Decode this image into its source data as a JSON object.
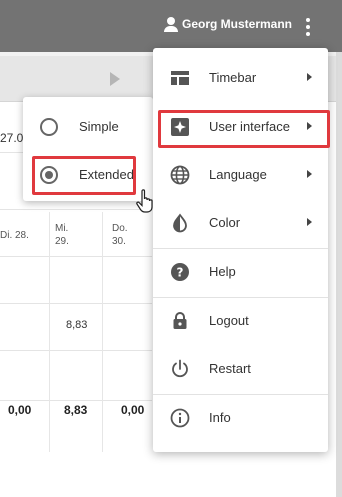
{
  "header": {
    "user_name": "Georg Mustermann",
    "user_icon": "account-icon",
    "more_icon": "more-vert-icon"
  },
  "toolbar": {
    "play_icon": "play-icon",
    "date_fragment": "27.0"
  },
  "table": {
    "columns": [
      {
        "day": "Di. 28.",
        "day2": ""
      },
      {
        "day": "Mi.",
        "day2": "29."
      },
      {
        "day": "Do.",
        "day2": "30."
      }
    ],
    "value": "8,83",
    "totals": [
      "0,00",
      "8,83",
      "0,00"
    ]
  },
  "submenu": {
    "items": [
      {
        "label": "Simple",
        "selected": false
      },
      {
        "label": "Extended",
        "selected": true
      }
    ]
  },
  "menu": {
    "items": [
      {
        "label": "Timebar",
        "icon": "timebar-icon",
        "submenu": true
      },
      {
        "label": "User interface",
        "icon": "user-interface-icon",
        "submenu": true
      },
      {
        "label": "Language",
        "icon": "globe-icon",
        "submenu": true
      },
      {
        "label": "Color",
        "icon": "color-icon",
        "submenu": true
      },
      {
        "label": "Help",
        "icon": "help-icon",
        "submenu": false
      },
      {
        "label": "Logout",
        "icon": "lock-icon",
        "submenu": false
      },
      {
        "label": "Restart",
        "icon": "power-icon",
        "submenu": false
      },
      {
        "label": "Info",
        "icon": "info-icon",
        "submenu": false
      }
    ]
  },
  "colors": {
    "appbar": "#737373",
    "highlight": "#e0393e",
    "icon": "#555555"
  }
}
